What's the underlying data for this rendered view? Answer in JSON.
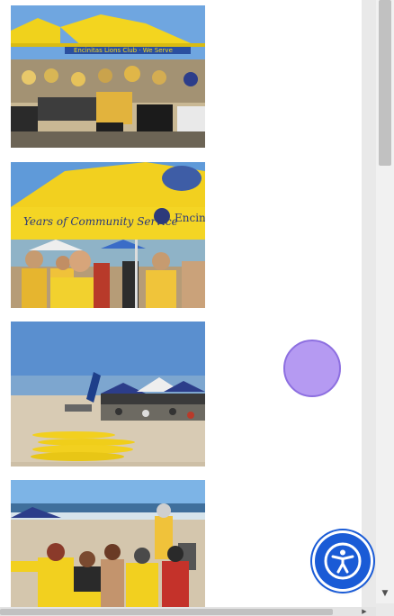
{
  "gallery": {
    "photos": [
      {
        "alt": "Volunteers in yellow shirts serving food under yellow canopy tents on the beach"
      },
      {
        "alt": "Smiling volunteers in yellow shirts under a yellow canopy tent at the beach"
      },
      {
        "alt": "Yellow surfboards lined up on the sand with tents and crowd"
      },
      {
        "alt": "Group of people in yellow shirts seated on the beach near the ocean"
      }
    ],
    "banner_text": {
      "tent_front": "Years of Community Service",
      "tent_side": "Encini",
      "tent_top_1": "Encinitas Lions Club · We Serve"
    }
  },
  "widgets": {
    "chat_bubble_color": "#b59af2",
    "accessibility_button_color": "#1a5bd6",
    "accessibility_label": "Accessibility"
  },
  "icons": {
    "accessibility": "accessibility-person-icon",
    "scroll_down": "chevron-down-icon",
    "scroll_right": "chevron-right-icon"
  }
}
